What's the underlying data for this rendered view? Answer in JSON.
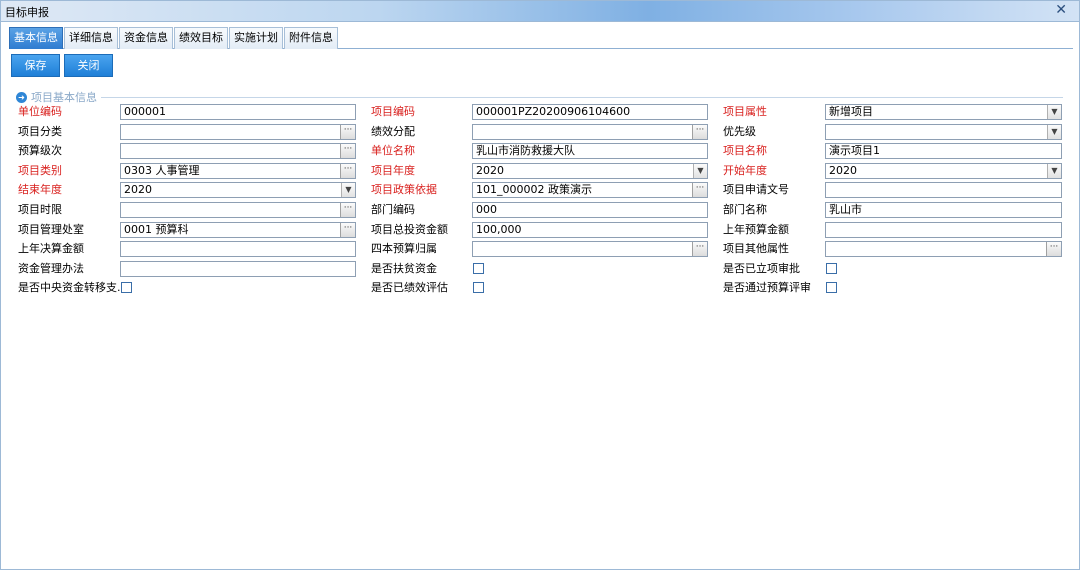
{
  "window": {
    "title": "目标申报",
    "close": "✕"
  },
  "tabs": [
    "基本信息",
    "详细信息",
    "资金信息",
    "绩效目标",
    "实施计划",
    "附件信息"
  ],
  "toolbar": {
    "save": "保存",
    "close": "关闭"
  },
  "section": {
    "title": "项目基本信息"
  },
  "colors": {
    "required_label": "#d9201e",
    "accent": "#2f86d6"
  },
  "form": {
    "rows": [
      [
        {
          "label": "单位编码",
          "required": true,
          "value": "000001",
          "control": "text"
        },
        {
          "label": "项目编码",
          "required": true,
          "value": "000001PZ20200906104600",
          "control": "text"
        },
        {
          "label": "项目属性",
          "required": true,
          "value": "新增项目",
          "control": "select"
        }
      ],
      [
        {
          "label": "项目分类",
          "required": false,
          "value": "",
          "control": "picker"
        },
        {
          "label": "绩效分配",
          "required": false,
          "value": "",
          "control": "picker"
        },
        {
          "label": "优先级",
          "required": false,
          "value": "",
          "control": "select"
        }
      ],
      [
        {
          "label": "预算级次",
          "required": false,
          "value": "",
          "control": "picker"
        },
        {
          "label": "单位名称",
          "required": true,
          "value": "乳山市消防救援大队",
          "control": "text"
        },
        {
          "label": "项目名称",
          "required": true,
          "value": "演示项目1",
          "control": "text"
        }
      ],
      [
        {
          "label": "项目类别",
          "required": true,
          "value": "0303 人事管理",
          "control": "picker"
        },
        {
          "label": "项目年度",
          "required": true,
          "value": "2020",
          "control": "select"
        },
        {
          "label": "开始年度",
          "required": true,
          "value": "2020",
          "control": "select"
        }
      ],
      [
        {
          "label": "结束年度",
          "required": true,
          "value": "2020",
          "control": "select"
        },
        {
          "label": "项目政策依据",
          "required": true,
          "value": "101_000002 政策演示",
          "control": "picker"
        },
        {
          "label": "项目申请文号",
          "required": false,
          "value": "",
          "control": "text"
        }
      ],
      [
        {
          "label": "项目时限",
          "required": false,
          "value": "",
          "control": "picker"
        },
        {
          "label": "部门编码",
          "required": false,
          "value": "000",
          "control": "text"
        },
        {
          "label": "部门名称",
          "required": false,
          "value": "乳山市",
          "control": "text"
        }
      ],
      [
        {
          "label": "项目管理处室",
          "required": false,
          "value": "0001 预算科",
          "control": "picker"
        },
        {
          "label": "项目总投资金额",
          "required": false,
          "value": "100,000",
          "control": "text"
        },
        {
          "label": "上年预算金额",
          "required": false,
          "value": "",
          "control": "text"
        }
      ],
      [
        {
          "label": "上年决算金额",
          "required": false,
          "value": "",
          "control": "text"
        },
        {
          "label": "四本预算归属",
          "required": false,
          "value": "",
          "control": "picker"
        },
        {
          "label": "项目其他属性",
          "required": false,
          "value": "",
          "control": "picker"
        }
      ],
      [
        {
          "label": "资金管理办法",
          "required": false,
          "value": "",
          "control": "text"
        },
        {
          "label": "是否扶贫资金",
          "required": false,
          "value": "",
          "control": "checkbox"
        },
        {
          "label": "是否已立项审批",
          "required": false,
          "value": "",
          "control": "checkbox"
        }
      ],
      [
        {
          "label": "是否中央资金转移支...",
          "required": false,
          "value": "",
          "control": "checkbox"
        },
        {
          "label": "是否已绩效评估",
          "required": false,
          "value": "",
          "control": "checkbox"
        },
        {
          "label": "是否通过预算评审",
          "required": false,
          "value": "",
          "control": "checkbox"
        }
      ]
    ]
  }
}
